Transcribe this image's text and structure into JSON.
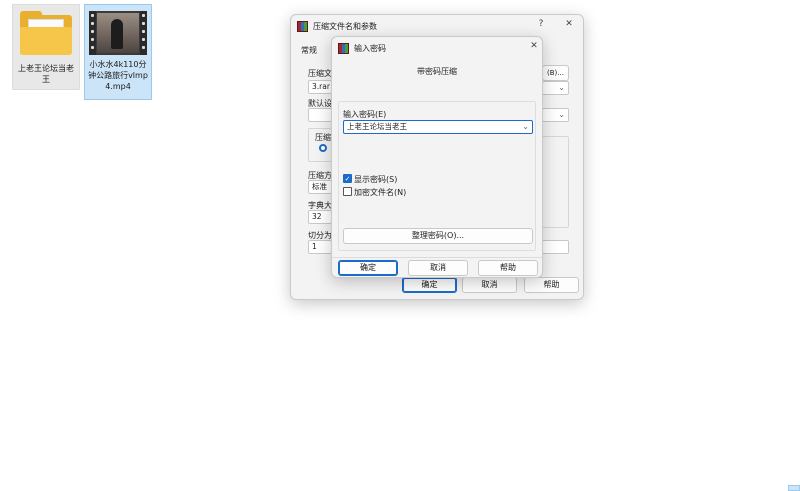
{
  "desktop": {
    "icons": [
      {
        "label": "上老王论坛当老王",
        "type": "folder"
      },
      {
        "label": "小水水4k110分钟公路旅行vlmp4.mp4",
        "type": "video"
      }
    ]
  },
  "main_dialog": {
    "title": "压缩文件名和参数",
    "help_glyph": "?",
    "close_glyph": "✕",
    "tab_general": "常规",
    "archive_name_label": "压缩文",
    "archive_name_value": "3.rar",
    "browse_label": "(B)...",
    "default_profile_label": "默认设",
    "format_group_label": "压缩",
    "method_label": "压缩方",
    "method_value": "标准",
    "dict_label": "字典大",
    "dict_value": "32",
    "split_label": "切分为",
    "split_value": "1",
    "ok_label": "确定",
    "cancel_label": "取消",
    "help_label": "帮助"
  },
  "password_dialog": {
    "title": "输入密码",
    "close_glyph": "✕",
    "heading": "带密码压缩",
    "enter_password_label": "输入密码(E)",
    "password_value": "上老王论坛当老王",
    "show_password_label": "显示密码(S)",
    "show_password_checked": true,
    "encrypt_names_label": "加密文件名(N)",
    "encrypt_names_checked": false,
    "organize_button_label": "整理密码(O)...",
    "ok_label": "确定",
    "cancel_label": "取消",
    "help_label": "帮助"
  },
  "icons": {
    "app": "winrar-icon",
    "chevron": "chevron-down-icon",
    "check": "checkmark-icon"
  },
  "colors": {
    "accent": "#1d6bc8",
    "selection_bg": "#cce4f7",
    "folder": "#f6c64a"
  }
}
